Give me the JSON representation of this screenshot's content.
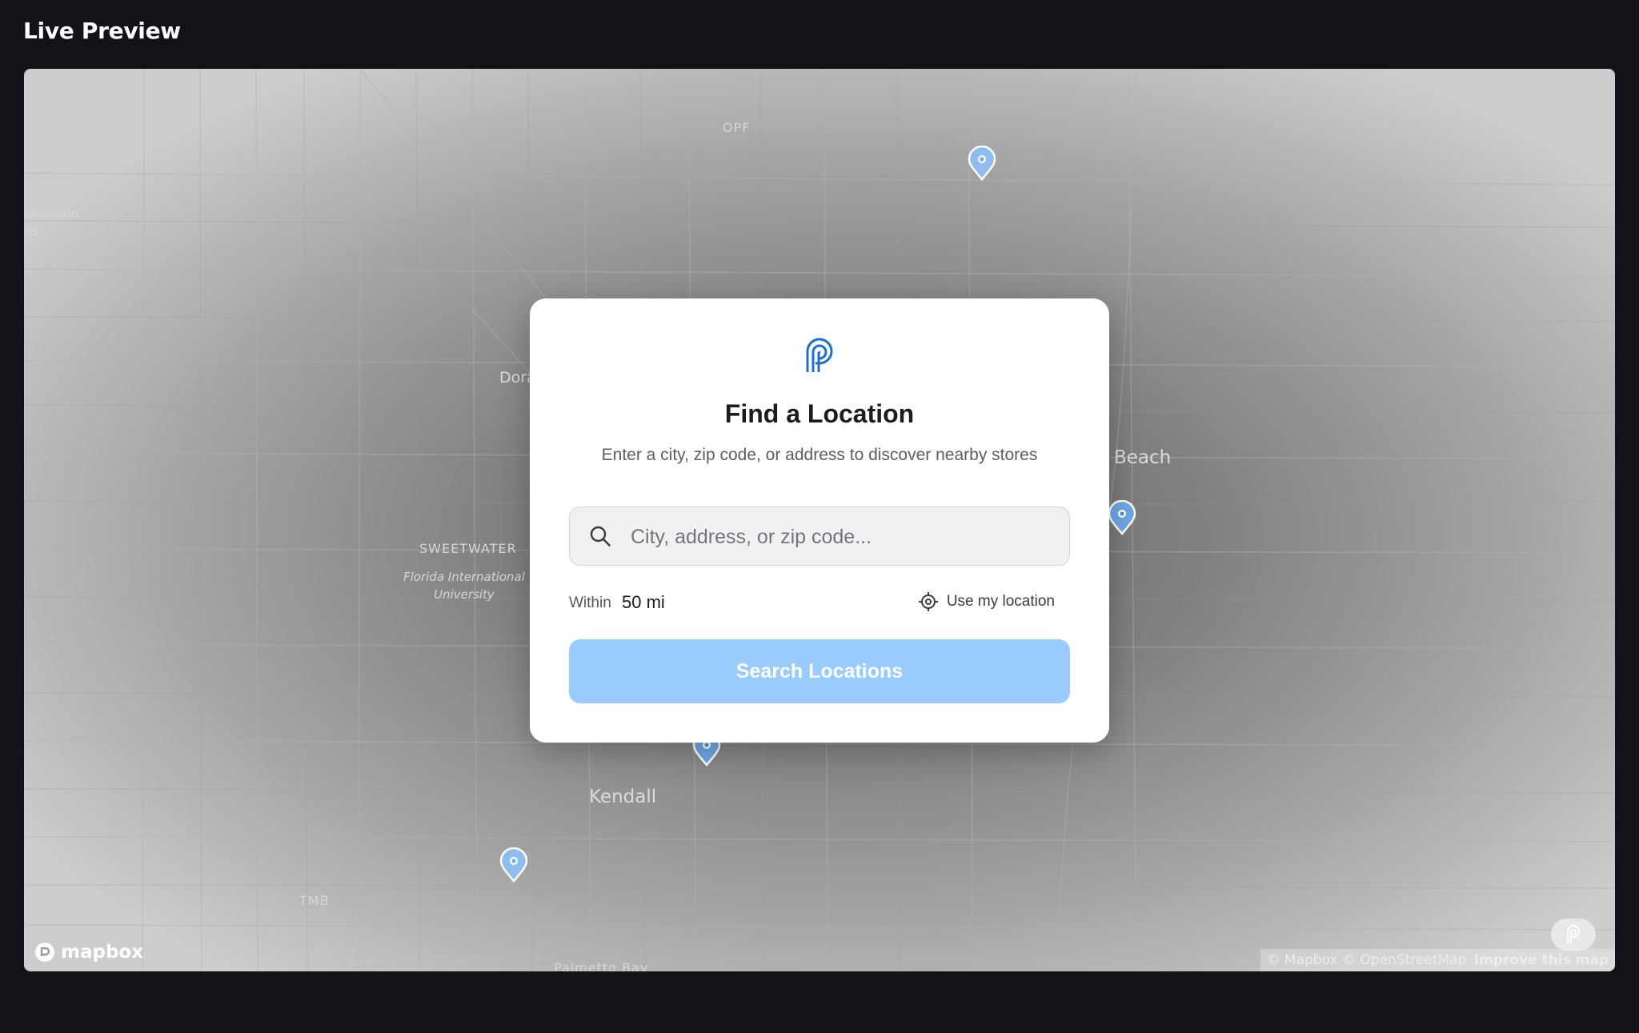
{
  "header": {
    "title": "Live Preview"
  },
  "map": {
    "labels": {
      "opf": "OPF",
      "conservation": "servation",
      "conservation2": "3B",
      "doral": "Dora",
      "beach": "Beach",
      "sweetwater": "SWEETWATER",
      "fiu": "Florida International",
      "fiu2": "University",
      "kendall": "Kendall",
      "tmb": "TMB",
      "palmetto": "Palmetto Bay"
    },
    "brand": "mapbox",
    "attribution": {
      "mapbox": "© Mapbox",
      "osm": "© OpenStreetMap",
      "improve": "Improve this map"
    },
    "pin_color": "#6fa8e6"
  },
  "card": {
    "logo_icon": "brand-p-logo",
    "title": "Find a Location",
    "subtitle": "Enter a city, zip code, or address to discover nearby stores",
    "search": {
      "placeholder": "City, address, or zip code...",
      "value": "",
      "icon": "search-icon"
    },
    "within_label": "Within",
    "within_value": "50 mi",
    "use_location_label": "Use my location",
    "use_location_icon": "crosshair-icon",
    "button_label": "Search Locations",
    "accent_color": "#1a6fd1",
    "button_color": "#99cbfd"
  }
}
